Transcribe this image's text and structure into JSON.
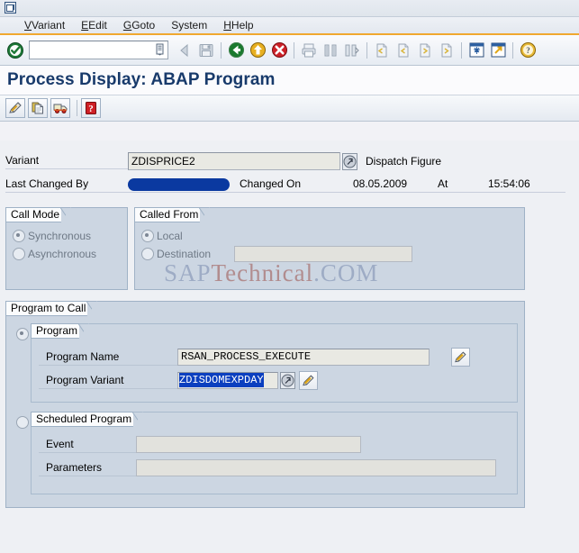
{
  "window": {
    "icon": "window-restore-icon"
  },
  "menubar": {
    "items": [
      {
        "label": "Variant",
        "accel": "V"
      },
      {
        "label": "Edit",
        "accel": "E"
      },
      {
        "label": "Goto",
        "accel": "G"
      },
      {
        "label": "System",
        "accel": "y"
      },
      {
        "label": "Help",
        "accel": "H"
      }
    ]
  },
  "toolbar": {
    "ok_icon": "green-check-enter-icon",
    "command_field": {
      "value": "",
      "placeholder": "",
      "dropdown_icon": "command-field-dropdown-icon"
    },
    "buttons": [
      {
        "name": "back-icon",
        "label": "Back"
      },
      {
        "name": "save-icon",
        "label": "Save"
      },
      {
        "name": "green-back-arrow-icon",
        "label": "Back"
      },
      {
        "name": "yellow-exit-icon",
        "label": "Exit"
      },
      {
        "name": "red-cancel-icon",
        "label": "Cancel"
      },
      {
        "name": "print-icon",
        "label": "Print"
      },
      {
        "name": "find-icon",
        "label": "Find"
      },
      {
        "name": "find-next-icon",
        "label": "Find Next"
      },
      {
        "name": "first-page-icon",
        "label": "First Page"
      },
      {
        "name": "previous-page-icon",
        "label": "Previous Page"
      },
      {
        "name": "next-page-icon",
        "label": "Next Page"
      },
      {
        "name": "last-page-icon",
        "label": "Last Page"
      },
      {
        "name": "create-session-icon",
        "label": "Create New Session"
      },
      {
        "name": "create-shortcut-icon",
        "label": "Create Shortcut"
      },
      {
        "name": "help-question-icon",
        "label": "Help"
      }
    ]
  },
  "screen": {
    "title": "Process Display: ABAP Program"
  },
  "app_toolbar": {
    "buttons": [
      {
        "name": "display-change-pencil-icon",
        "label": "Display/Change"
      },
      {
        "name": "copy-document-icon",
        "label": "Copy"
      },
      {
        "name": "delivery-truck-icon",
        "label": "Transport"
      },
      {
        "name": "help-red-question-icon",
        "label": "Help"
      }
    ]
  },
  "header": {
    "variant_label": "Variant",
    "variant_value": "ZDISPRICE2",
    "variant_f4_icon": "search-help-icon",
    "dispatch_text": "Dispatch Figure",
    "last_changed_by_label": "Last Changed By",
    "last_changed_by_value": "",
    "changed_on_label": "Changed On",
    "changed_on_value": "08.05.2009",
    "at_label": "At",
    "at_value": "15:54:06"
  },
  "call_mode": {
    "title": "Call Mode",
    "options": [
      {
        "label": "Synchronous",
        "selected": true
      },
      {
        "label": "Asynchronous",
        "selected": false
      }
    ]
  },
  "called_from": {
    "title": "Called From",
    "options": [
      {
        "label": "Local",
        "selected": true
      },
      {
        "label": "Destination",
        "selected": false
      }
    ],
    "destination_value": ""
  },
  "program_to_call": {
    "title": "Program to Call",
    "program_group": {
      "title": "Program",
      "selected": true,
      "program_name_label": "Program Name",
      "program_name_value": "RSAN_PROCESS_EXECUTE",
      "program_name_edit_icon": "pencil-edit-icon",
      "program_variant_label": "Program Variant",
      "program_variant_value": "ZDISDOMEXPDAY",
      "program_variant_f4_icon": "search-help-icon",
      "program_variant_edit_icon": "pencil-edit-icon"
    },
    "scheduled_group": {
      "title": "Scheduled Program",
      "selected": false,
      "event_label": "Event",
      "event_value": "",
      "parameters_label": "Parameters",
      "parameters_value": ""
    }
  },
  "watermark": {
    "part1": "SAP",
    "part2": "Technical",
    "part3": ".COM",
    "color1": "#8293b4",
    "color2": "#a2605c"
  },
  "colors": {
    "title_blue": "#183a6b",
    "accent_orange": "#f0a830",
    "group_bg": "#ccd6e2",
    "canvas_bg": "#eef0f4",
    "selection_blue": "#0b3fbf",
    "redaction_blue": "#0a39a0"
  }
}
